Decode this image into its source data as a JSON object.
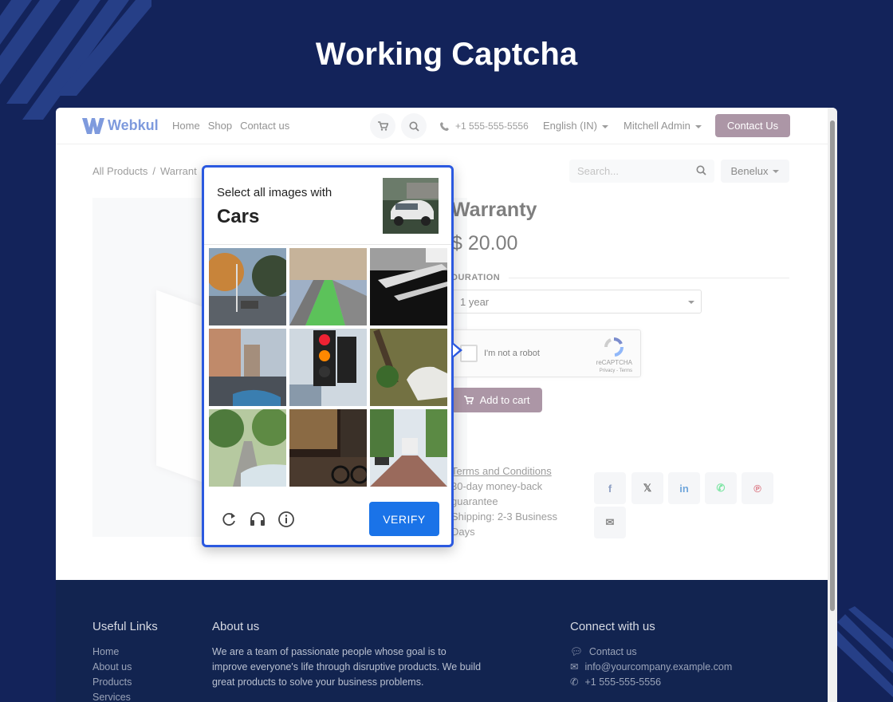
{
  "hero": {
    "title": "Working Captcha"
  },
  "navbar": {
    "brand": "Webkul",
    "links": [
      "Home",
      "Shop",
      "Contact us"
    ],
    "phone": "+1 555-555-5556",
    "language": "English (IN)",
    "user": "Mitchell Admin",
    "contact_button": "Contact Us"
  },
  "breadcrumb": {
    "root": "All Products",
    "sep": "/",
    "current": "Warrant"
  },
  "search": {
    "placeholder": "Search..."
  },
  "pricelist": {
    "label": "Benelux"
  },
  "product": {
    "title": "Warranty",
    "price": "$ 20.00",
    "attribute_label": "DURATION",
    "duration_value": "1 year",
    "add_to_cart": "Add to cart",
    "terms_link": "Terms and Conditions",
    "terms_lines": [
      "30-day money-back",
      "guarantee",
      "Shipping: 2-3 Business",
      "Days"
    ]
  },
  "recaptcha": {
    "label": "I'm not a robot",
    "brand": "reCAPTCHA",
    "legal": "Privacy - Terms"
  },
  "share": {
    "icons": [
      "facebook-icon",
      "x-icon",
      "linkedin-icon",
      "whatsapp-icon",
      "pinterest-icon",
      "email-icon"
    ],
    "glyphs": [
      "f",
      "𝕏",
      "in",
      "✆",
      "℗",
      "✉"
    ]
  },
  "captcha": {
    "prompt": "Select all images with",
    "target": "Cars",
    "verify": "VERIFY",
    "controls": [
      "reload-icon",
      "audio-icon",
      "info-icon"
    ]
  },
  "footer": {
    "useful_links_title": "Useful Links",
    "useful_links": [
      "Home",
      "About us",
      "Products",
      "Services"
    ],
    "about_title": "About us",
    "about_text": "We are a team of passionate people whose goal is to improve everyone's life through disruptive products. We build great products to solve your business problems.",
    "connect_title": "Connect with us",
    "connect_items": [
      "Contact us",
      "info@yourcompany.example.com",
      "+1 555-555-5556"
    ]
  },
  "colors": {
    "page_bg": "#13235a",
    "brand_blue": "#2151c4",
    "odoo_purple": "#714b67",
    "captcha_border": "#2b59e0",
    "verify_blue": "#1a73e8",
    "footer_bg": "#122450"
  }
}
